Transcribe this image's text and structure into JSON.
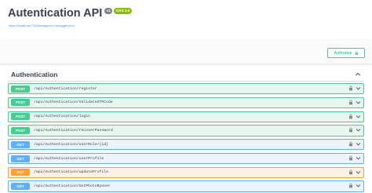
{
  "info": {
    "title": "Autentication API",
    "version_badge": "v1",
    "oas_badge": "OAS 3.0",
    "spec_url": "https://localhost:7184/swagger/v1/swagger.json"
  },
  "scheme": {
    "authorize_label": "Authorize"
  },
  "tag": {
    "name": "Authentication"
  },
  "operations": [
    {
      "method": "POST",
      "path": "/api/Authentication/register"
    },
    {
      "method": "POST",
      "path": "/api/Authentication/ValidateOTPCode"
    },
    {
      "method": "POST",
      "path": "/api/Authentication/login"
    },
    {
      "method": "POST",
      "path": "/api/Authentication/recoverPassword"
    },
    {
      "method": "GET",
      "path": "/api/Authentication/userRole/{id}"
    },
    {
      "method": "GET",
      "path": "/api/Authentication/userProfile"
    },
    {
      "method": "PUT",
      "path": "/api/Authentication/updateProfile"
    },
    {
      "method": "GET",
      "path": "/api/Authentication/GetPhotoByUser"
    }
  ],
  "colors": {
    "post": "#49cc90",
    "get": "#61affe",
    "put": "#fca130"
  },
  "icons": {
    "authorize": "unlock-icon",
    "operation": "lock-icon",
    "expand": "chevron-down-icon",
    "collapse": "chevron-up-icon"
  }
}
